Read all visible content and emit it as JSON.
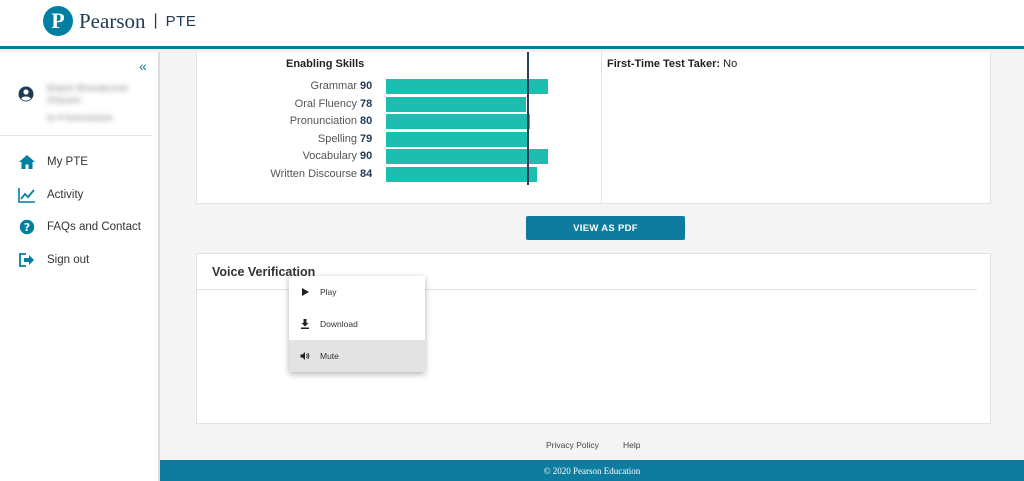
{
  "header": {
    "logo_letter": "P",
    "brand": "Pearson",
    "separator": "|",
    "product": "PTE"
  },
  "sidebar": {
    "collapse_glyph": "«",
    "user": {
      "name": "Brijesh Bharatkumar Dhanani",
      "id": "ID PTE001000020"
    },
    "items": [
      {
        "label": "My PTE",
        "icon": "home-icon"
      },
      {
        "label": "Activity",
        "icon": "chart-line-icon"
      },
      {
        "label": "FAQs and Contact",
        "icon": "question-icon"
      },
      {
        "label": "Sign out",
        "icon": "sign-out-icon"
      }
    ]
  },
  "skills": {
    "title": "Enabling Skills",
    "rows": [
      {
        "label": "Grammar",
        "score": "90",
        "value": 90
      },
      {
        "label": "Oral Fluency",
        "score": "78",
        "value": 78
      },
      {
        "label": "Pronunciation",
        "score": "80",
        "value": 80
      },
      {
        "label": "Spelling",
        "score": "79",
        "value": 79
      },
      {
        "label": "Vocabulary",
        "score": "90",
        "value": 90
      },
      {
        "label": "Written Discourse",
        "score": "84",
        "value": 84
      }
    ],
    "reference_score": 79,
    "scale_max": 90
  },
  "test_info": {
    "first_time_label": "First-Time Test Taker:",
    "first_time_value": "No"
  },
  "pdf_button": "VIEW AS PDF",
  "voice": {
    "title": "Voice Verification",
    "menu": [
      {
        "label": "Play",
        "icon": "play-icon"
      },
      {
        "label": "Download",
        "icon": "download-icon"
      },
      {
        "label": "Mute",
        "icon": "volume-icon"
      }
    ]
  },
  "footer": {
    "privacy": "Privacy Policy",
    "help": "Help",
    "copyright": "© 2020 Pearson Education"
  },
  "colors": {
    "brand": "#007fa3",
    "bar": "#1dbdb0",
    "footer": "#0e7c9e"
  }
}
